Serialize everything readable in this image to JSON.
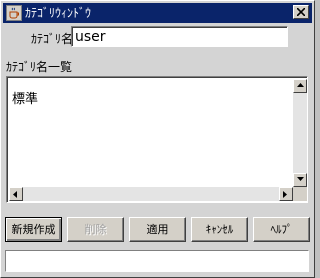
{
  "window": {
    "title": "ｶﾃｺﾞﾘｳｨﾝﾄﾞｳ",
    "close_glyph": "✕"
  },
  "form": {
    "name_label": "ｶﾃｺﾞﾘ名",
    "name_value": "user"
  },
  "list": {
    "heading": "ｶﾃｺﾞﾘ名一覧",
    "items": [
      "標準"
    ]
  },
  "buttons": {
    "new_label": "新規作成",
    "delete_label": "削除",
    "apply_label": "適用",
    "cancel_label": "ｷｬﾝｾﾙ",
    "help_label": "ﾍﾙﾌﾟ"
  },
  "status": {
    "text": ""
  },
  "colors": {
    "titlebar": "#0a246a",
    "face": "#d4d0c8"
  }
}
